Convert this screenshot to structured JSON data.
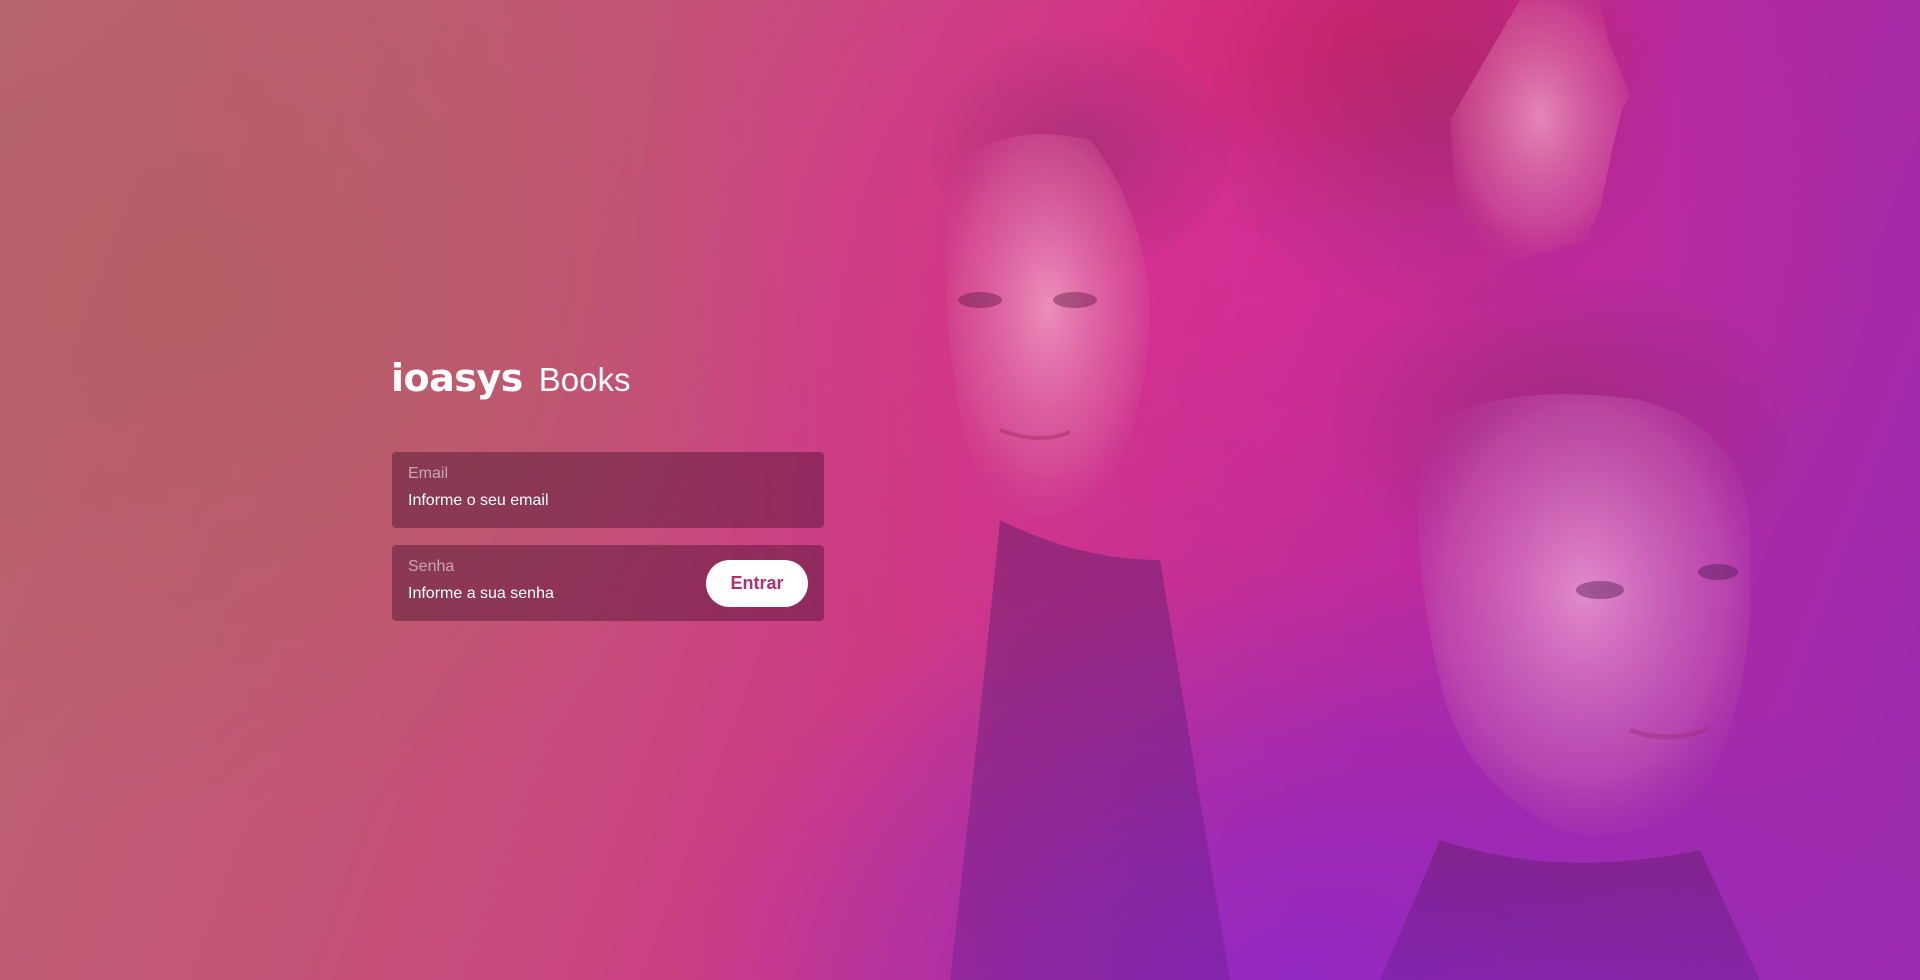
{
  "logo": {
    "brand": "ioasys",
    "product": "Books"
  },
  "login": {
    "email": {
      "label": "Email",
      "placeholder": "Informe o seu email"
    },
    "password": {
      "label": "Senha",
      "placeholder": "Informe a sua senha"
    },
    "submit_label": "Entrar"
  },
  "colors": {
    "button_text": "#b22e6f",
    "background_warm": "#b86670",
    "background_magenta": "#cd3a86",
    "background_purple": "#9a2bb0"
  }
}
